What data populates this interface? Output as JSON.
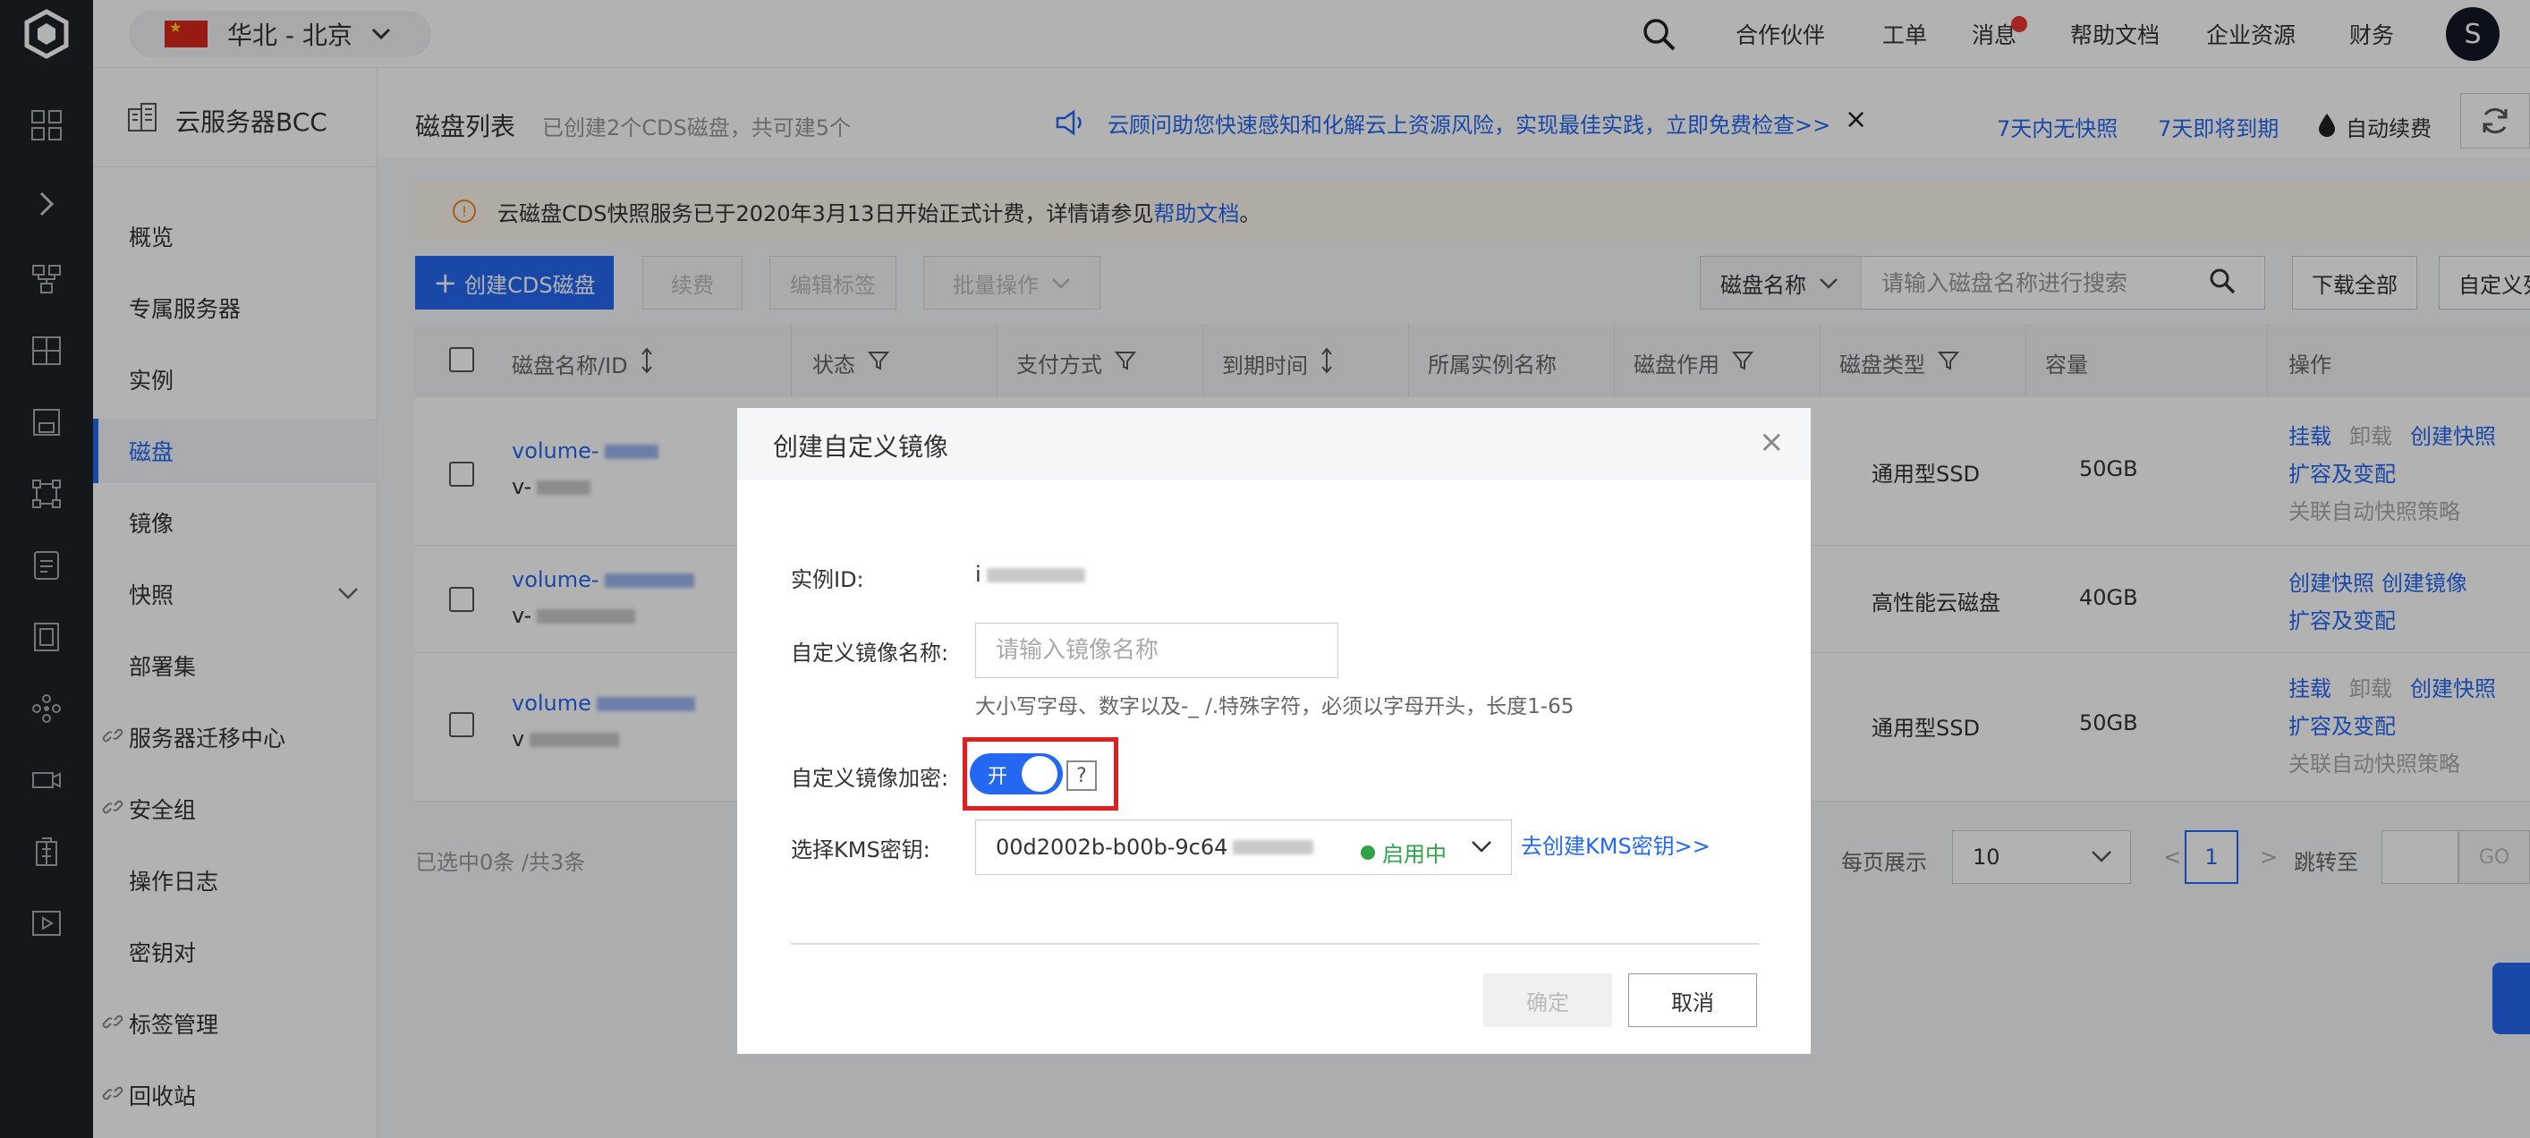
{
  "topbar": {
    "region": "华北 - 北京",
    "nav": [
      "合作伙伴",
      "工单",
      "消息",
      "帮助文档",
      "企业资源",
      "财务"
    ],
    "avatar_letter": "S"
  },
  "sidebar": {
    "service_title": "云服务器BCC",
    "items": [
      {
        "label": "概览"
      },
      {
        "label": "专属服务器"
      },
      {
        "label": "实例"
      },
      {
        "label": "磁盘"
      },
      {
        "label": "镜像"
      },
      {
        "label": "快照"
      },
      {
        "label": "部署集"
      },
      {
        "label": "服务器迁移中心"
      },
      {
        "label": "安全组"
      },
      {
        "label": "操作日志"
      },
      {
        "label": "密钥对"
      },
      {
        "label": "标签管理"
      },
      {
        "label": "回收站"
      }
    ],
    "active_index": 3
  },
  "page": {
    "title": "磁盘列表",
    "subtitle": "已创建2个CDS磁盘，共可建5个",
    "notice": "云顾问助您快速感知和化解云上资源风险，实现最佳实践，立即免费检查>>",
    "link_no_snapshot": "7天内无快照",
    "link_expiring": "7天即将到期",
    "auto_renew": "自动续费"
  },
  "banner": {
    "text": "云磁盘CDS快照服务已于2020年3月13日开始正式计费，详情请参见",
    "link": "帮助文档",
    "tail": "。"
  },
  "toolbar": {
    "create": "创建CDS磁盘",
    "renew": "续费",
    "edit_tags": "编辑标签",
    "batch": "批量操作",
    "search_field": "磁盘名称",
    "search_placeholder": "请输入磁盘名称进行搜索",
    "download_all": "下载全部",
    "custom_columns": "自定义列"
  },
  "table": {
    "columns": [
      "磁盘名称/ID",
      "状态",
      "支付方式",
      "到期时间",
      "所属实例名称",
      "磁盘作用",
      "磁盘类型",
      "容量",
      "操作"
    ],
    "rows": [
      {
        "name": "volume-",
        "id": "v-",
        "type": "通用型SSD",
        "capacity": "50GB",
        "actions": [
          "挂载",
          "卸载",
          "创建快照",
          "扩容及变配",
          "关联自动快照策略"
        ]
      },
      {
        "name": "volume-",
        "id": "v-",
        "type": "高性能云磁盘",
        "capacity": "40GB",
        "actions": [
          "创建快照",
          "创建镜像",
          "扩容及变配"
        ]
      },
      {
        "name": "volume",
        "id": "v",
        "type": "通用型SSD",
        "capacity": "50GB",
        "actions": [
          "挂载",
          "卸载",
          "创建快照",
          "扩容及变配",
          "关联自动快照策略"
        ]
      }
    ]
  },
  "footer": {
    "selected": "已选中0条 /共3条",
    "per_page_label": "每页展示",
    "per_page": "10",
    "prev": "<",
    "page": "1",
    "next": ">",
    "jump_label": "跳转至",
    "go": "GO"
  },
  "modal": {
    "title": "创建自定义镜像",
    "instance_id_label": "实例ID:",
    "instance_id_value": "i",
    "name_label": "自定义镜像名称:",
    "name_placeholder": "请输入镜像名称",
    "name_hint": "大小写字母、数字以及-_ /.特殊字符，必须以字母开头，长度1-65",
    "encrypt_label": "自定义镜像加密:",
    "encrypt_toggle": "开",
    "encrypt_help": "?",
    "kms_label": "选择KMS密钥:",
    "kms_value": "00d2002b-b00b-9c64",
    "kms_status": "启用中",
    "kms_link": "去创建KMS密钥>>",
    "confirm": "确定",
    "cancel": "取消"
  },
  "colors": {
    "accent": "#2468f2",
    "highlight": "#e02020",
    "enabled": "#2fa34a"
  }
}
